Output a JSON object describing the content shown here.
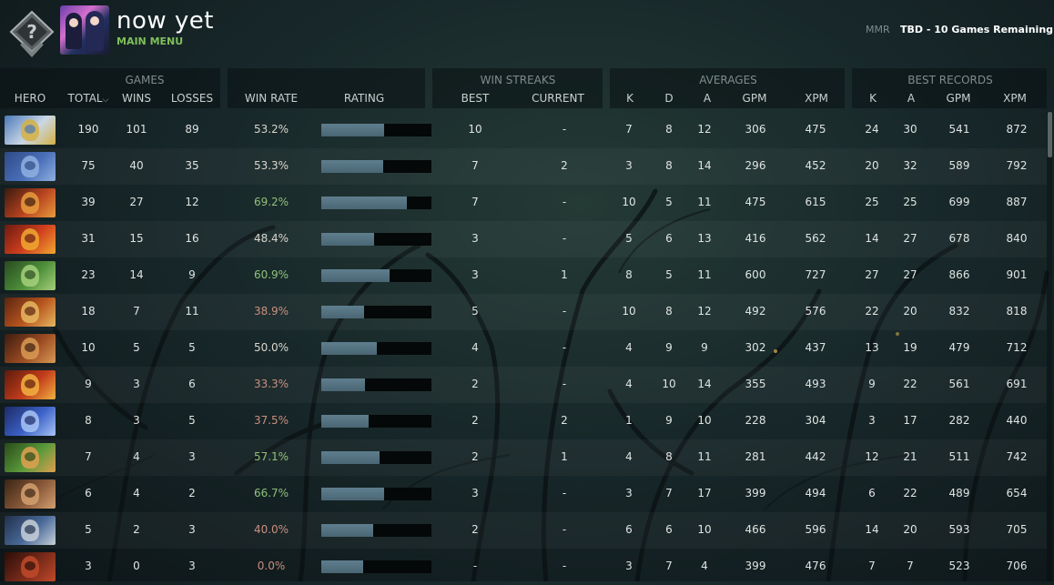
{
  "header": {
    "username": "now yet",
    "main_menu": "MAIN MENU",
    "mmr_label": "MMR",
    "mmr_value": "TBD - 10 Games Remaining"
  },
  "groups": {
    "games": "GAMES",
    "win_streaks": "WIN STREAKS",
    "averages": "AVERAGES",
    "best_records": "BEST RECORDS"
  },
  "columns": {
    "hero": "HERO",
    "total": "TOTAL",
    "wins": "WINS",
    "losses": "LOSSES",
    "win_rate": "WIN RATE",
    "rating": "RATING",
    "best": "BEST",
    "current": "CURRENT",
    "avg_k": "K",
    "avg_d": "D",
    "avg_a": "A",
    "avg_gpm": "GPM",
    "avg_xpm": "XPM",
    "best_k": "K",
    "best_a": "A",
    "best_gpm": "GPM",
    "best_xpm": "XPM"
  },
  "colors": {
    "accent_green": "#7fbf5a",
    "win_rate_high": "#8fc07a",
    "win_rate_low": "#c98f7e",
    "rating_fill": "#5f7e8e"
  },
  "rows": [
    {
      "hero_icon": "keeper-of-the-light-portrait",
      "total": "190",
      "wins": "101",
      "losses": "89",
      "win_rate": "53.2%",
      "rating": 0.57,
      "best": "10",
      "current": "-",
      "k": "7",
      "d": "8",
      "a": "12",
      "gpm": "306",
      "xpm": "475",
      "bk": "24",
      "ba": "30",
      "bgpm": "541",
      "bxpm": "872"
    },
    {
      "hero_icon": "ogre-magi-portrait",
      "total": "75",
      "wins": "40",
      "losses": "35",
      "win_rate": "53.3%",
      "rating": 0.56,
      "best": "7",
      "current": "2",
      "k": "3",
      "d": "8",
      "a": "14",
      "gpm": "296",
      "xpm": "452",
      "bk": "20",
      "ba": "32",
      "bgpm": "589",
      "bxpm": "792"
    },
    {
      "hero_icon": "shadow-fiend-portrait",
      "total": "39",
      "wins": "27",
      "losses": "12",
      "win_rate": "69.2%",
      "rating": 0.78,
      "best": "7",
      "current": "-",
      "k": "10",
      "d": "5",
      "a": "11",
      "gpm": "475",
      "xpm": "615",
      "bk": "25",
      "ba": "25",
      "bgpm": "699",
      "bxpm": "887"
    },
    {
      "hero_icon": "lina-portrait",
      "total": "31",
      "wins": "15",
      "losses": "16",
      "win_rate": "48.4%",
      "rating": 0.48,
      "best": "3",
      "current": "-",
      "k": "5",
      "d": "6",
      "a": "13",
      "gpm": "416",
      "xpm": "562",
      "bk": "14",
      "ba": "27",
      "bgpm": "678",
      "bxpm": "840"
    },
    {
      "hero_icon": "tiny-portrait",
      "total": "23",
      "wins": "14",
      "losses": "9",
      "win_rate": "60.9%",
      "rating": 0.62,
      "best": "3",
      "current": "1",
      "k": "8",
      "d": "5",
      "a": "11",
      "gpm": "600",
      "xpm": "727",
      "bk": "27",
      "ba": "27",
      "bgpm": "866",
      "bxpm": "901"
    },
    {
      "hero_icon": "huskar-portrait",
      "total": "18",
      "wins": "7",
      "losses": "11",
      "win_rate": "38.9%",
      "rating": 0.39,
      "best": "5",
      "current": "-",
      "k": "10",
      "d": "8",
      "a": "12",
      "gpm": "492",
      "xpm": "576",
      "bk": "22",
      "ba": "20",
      "bgpm": "832",
      "bxpm": "818"
    },
    {
      "hero_icon": "earthshaker-portrait",
      "total": "10",
      "wins": "5",
      "losses": "5",
      "win_rate": "50.0%",
      "rating": 0.5,
      "best": "4",
      "current": "-",
      "k": "4",
      "d": "9",
      "a": "9",
      "gpm": "302",
      "xpm": "437",
      "bk": "13",
      "ba": "19",
      "bgpm": "479",
      "bxpm": "712"
    },
    {
      "hero_icon": "batrider-portrait",
      "total": "9",
      "wins": "3",
      "losses": "6",
      "win_rate": "33.3%",
      "rating": 0.4,
      "best": "2",
      "current": "-",
      "k": "4",
      "d": "10",
      "a": "14",
      "gpm": "355",
      "xpm": "493",
      "bk": "9",
      "ba": "22",
      "bgpm": "561",
      "bxpm": "691"
    },
    {
      "hero_icon": "storm-spirit-portrait",
      "total": "8",
      "wins": "3",
      "losses": "5",
      "win_rate": "37.5%",
      "rating": 0.43,
      "best": "2",
      "current": "2",
      "k": "1",
      "d": "9",
      "a": "10",
      "gpm": "228",
      "xpm": "304",
      "bk": "3",
      "ba": "17",
      "bgpm": "282",
      "bxpm": "440"
    },
    {
      "hero_icon": "windranger-portrait",
      "total": "7",
      "wins": "4",
      "losses": "3",
      "win_rate": "57.1%",
      "rating": 0.53,
      "best": "2",
      "current": "1",
      "k": "4",
      "d": "8",
      "a": "11",
      "gpm": "281",
      "xpm": "442",
      "bk": "12",
      "ba": "21",
      "bgpm": "511",
      "bxpm": "742"
    },
    {
      "hero_icon": "bristleback-portrait",
      "total": "6",
      "wins": "4",
      "losses": "2",
      "win_rate": "66.7%",
      "rating": 0.57,
      "best": "3",
      "current": "-",
      "k": "3",
      "d": "7",
      "a": "17",
      "gpm": "399",
      "xpm": "494",
      "bk": "6",
      "ba": "22",
      "bgpm": "489",
      "bxpm": "654"
    },
    {
      "hero_icon": "sven-portrait",
      "total": "5",
      "wins": "2",
      "losses": "3",
      "win_rate": "40.0%",
      "rating": 0.47,
      "best": "2",
      "current": "-",
      "k": "6",
      "d": "6",
      "a": "10",
      "gpm": "466",
      "xpm": "596",
      "bk": "14",
      "ba": "20",
      "bgpm": "593",
      "bxpm": "705"
    },
    {
      "hero_icon": "lion-portrait",
      "total": "3",
      "wins": "0",
      "losses": "3",
      "win_rate": "0.0%",
      "rating": 0.38,
      "best": "-",
      "current": "-",
      "k": "3",
      "d": "7",
      "a": "4",
      "gpm": "399",
      "xpm": "476",
      "bk": "7",
      "ba": "7",
      "bgpm": "523",
      "bxpm": "706"
    }
  ]
}
